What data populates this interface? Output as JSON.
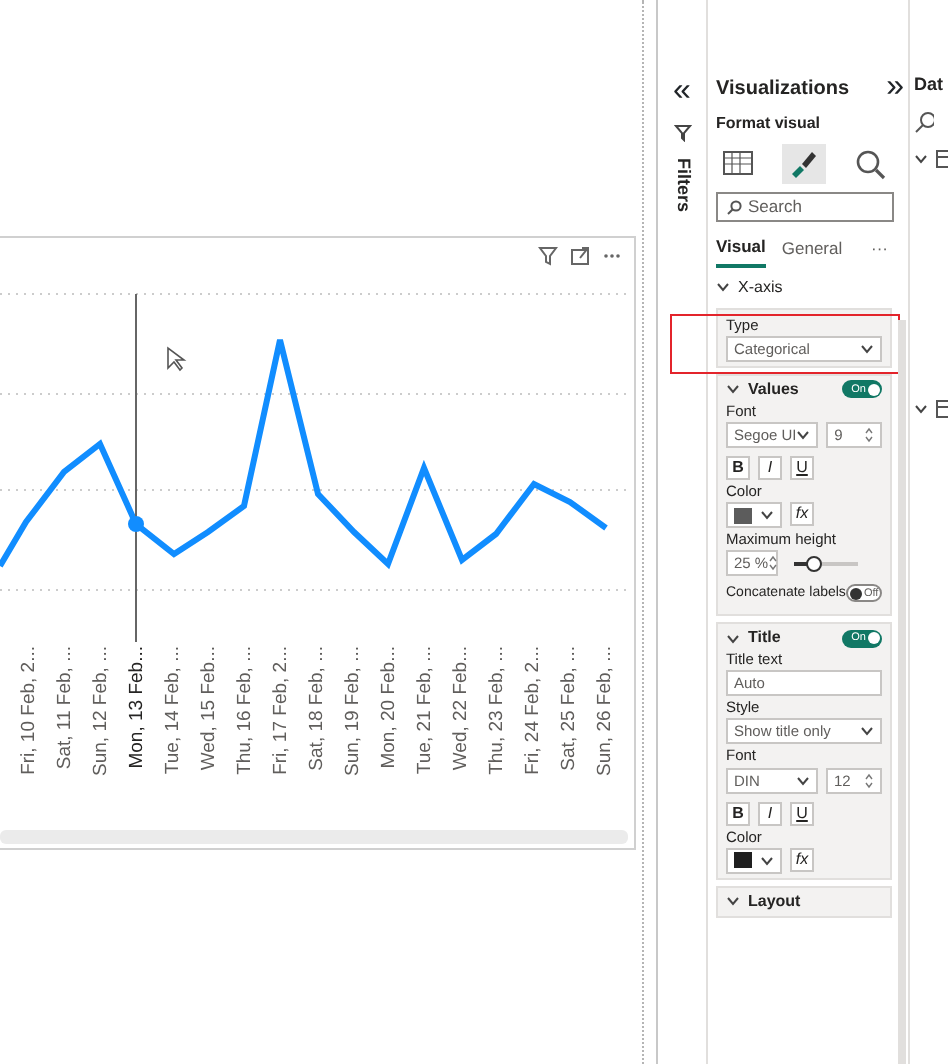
{
  "visual": {
    "x_labels": [
      {
        "label": "Fri, 10 Feb, 2...",
        "hovered": false
      },
      {
        "label": "Sat, 11 Feb, ...",
        "hovered": false
      },
      {
        "label": "Sun, 12 Feb, ...",
        "hovered": false
      },
      {
        "label": "Mon, 13 Feb...",
        "hovered": true
      },
      {
        "label": "Tue, 14 Feb, ...",
        "hovered": false
      },
      {
        "label": "Wed, 15 Feb...",
        "hovered": false
      },
      {
        "label": "Thu, 16 Feb, ...",
        "hovered": false
      },
      {
        "label": "Fri, 17 Feb, 2...",
        "hovered": false
      },
      {
        "label": "Sat, 18 Feb, ...",
        "hovered": false
      },
      {
        "label": "Sun, 19 Feb, ...",
        "hovered": false
      },
      {
        "label": "Mon, 20 Feb...",
        "hovered": false
      },
      {
        "label": "Tue, 21 Feb, ...",
        "hovered": false
      },
      {
        "label": "Wed, 22 Feb...",
        "hovered": false
      },
      {
        "label": "Thu, 23 Feb, ...",
        "hovered": false
      },
      {
        "label": "Fri, 24 Feb, 2...",
        "hovered": false
      },
      {
        "label": "Sat, 25 Feb, ...",
        "hovered": false
      },
      {
        "label": "Sun, 26 Feb, ...",
        "hovered": false
      }
    ]
  },
  "filters": {
    "collapse": "«",
    "label": "Filters"
  },
  "visualizations": {
    "title": "Visualizations",
    "expand": "»",
    "subtitle": "Format visual",
    "view_icons": [
      {
        "selected": false
      },
      {
        "selected": true
      },
      {
        "selected": false
      }
    ],
    "search": {
      "placeholder": "Search"
    },
    "tabs": [
      {
        "label": "Visual",
        "selected": true
      },
      {
        "label": "General",
        "selected": false
      }
    ],
    "more": "···",
    "section": {
      "title": "X-axis",
      "expanded": true
    },
    "cards": [
      {
        "highlighted": true,
        "rows": [
          {
            "kind": "label",
            "text": "Type"
          },
          {
            "kind": "dropdown",
            "value": "Categorical"
          }
        ]
      },
      {
        "highlighted": false,
        "header": {
          "title": "Values",
          "expanded": true,
          "toggle": {
            "on": true,
            "text": "On"
          }
        },
        "rows": [
          {
            "kind": "label",
            "text": "Font"
          },
          {
            "kind": "font",
            "family": "Segoe UI",
            "size": "9"
          },
          {
            "kind": "styles",
            "buttons": [
              "B",
              "I",
              "U"
            ]
          },
          {
            "kind": "label",
            "text": "Color"
          },
          {
            "kind": "color",
            "color": "#5c5c5c",
            "fx": "fx"
          },
          {
            "kind": "label",
            "text": "Maximum height"
          },
          {
            "kind": "slider",
            "value": "25 %",
            "level": 0.3
          },
          {
            "kind": "toggle",
            "text": "Concatenate labels",
            "toggle": {
              "on": false,
              "text": "Off"
            }
          }
        ]
      },
      {
        "highlighted": false,
        "header": {
          "title": "Title",
          "expanded": true,
          "toggle": {
            "on": true,
            "text": "On"
          }
        },
        "rows": [
          {
            "kind": "label",
            "text": "Title text"
          },
          {
            "kind": "input",
            "value": "Auto"
          },
          {
            "kind": "label",
            "text": "Style"
          },
          {
            "kind": "dropdown",
            "value": "Show title only"
          },
          {
            "kind": "label",
            "text": "Font"
          },
          {
            "kind": "font",
            "family": "DIN",
            "size": "12"
          },
          {
            "kind": "styles",
            "buttons": [
              "B",
              "I",
              "U"
            ]
          },
          {
            "kind": "label",
            "text": "Color"
          },
          {
            "kind": "color",
            "color": "#1f1f1f",
            "fx": "fx"
          }
        ]
      },
      {
        "highlighted": false,
        "header": {
          "title": "Layout",
          "expanded": true
        }
      }
    ]
  },
  "data": {
    "title": "Dat",
    "items": [
      {
        "expanded": true
      },
      {
        "expanded": true
      }
    ]
  }
}
